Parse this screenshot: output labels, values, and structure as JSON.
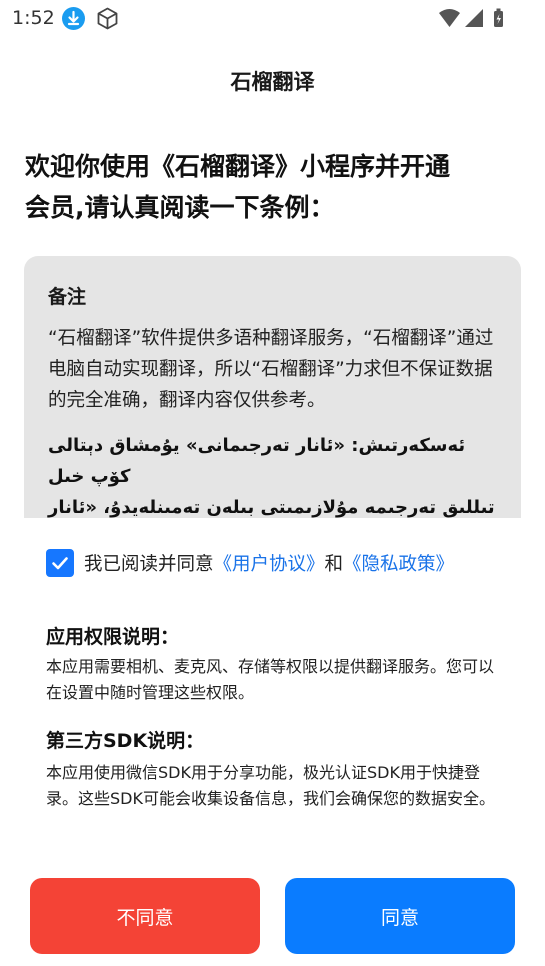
{
  "status_bar": {
    "time": "1:52",
    "icons": [
      "download-icon",
      "cube-icon",
      "wifi-icon",
      "signal-icon",
      "battery-charging-icon"
    ]
  },
  "header": {
    "title": "石榴翻译"
  },
  "intro": {
    "heading_line1": "欢迎你使用《石榴翻译》小程序并开通",
    "heading_line2": "会员,请认真阅读一下条例："
  },
  "notice": {
    "title": "备注",
    "body": "“石榴翻译”软件提供多语种翻译服务，“石榴翻译”通过电脑自动实现翻译，所以“石榴翻译”力求但不保证数据的完全准确，翻译内容仅供参考。",
    "uyghur_line1": "ئەسكەرتىش: «ئانار تەرجىمانى» يۇمشاق دېتالى كۆپ خىل",
    "uyghur_line2": "تىللىق تەرجىمە مۇلازىمىتى بىلەن تەمىنلەيدۇ، «ئانار"
  },
  "agreement": {
    "checked": true,
    "prefix": "我已阅读并同意",
    "user_agreement": "《用户协议》",
    "and": "和",
    "privacy_policy": "《隐私政策》"
  },
  "permissions": {
    "title": "应用权限说明：",
    "body": "本应用需要相机、麦克风、存储等权限以提供翻译服务。您可以在设置中随时管理这些权限。"
  },
  "sdk": {
    "title": "第三方SDK说明：",
    "body": "本应用使用微信SDK用于分享功能，极光认证SDK用于快捷登录。这些SDK可能会收集设备信息，我们会确保您的数据安全。"
  },
  "buttons": {
    "decline": "不同意",
    "accept": "同意"
  },
  "colors": {
    "accent": "#0a7cff",
    "decline": "#f44336",
    "link": "#1a73e8",
    "notice_bg": "#e5e5e5"
  }
}
